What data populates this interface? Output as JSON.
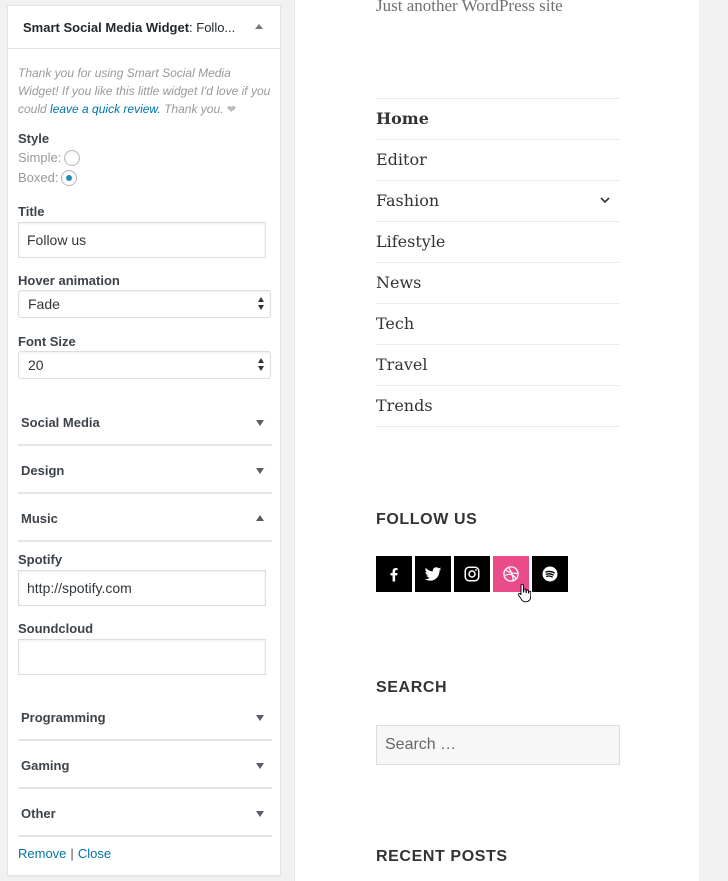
{
  "widget": {
    "title_bold": "Smart Social Media Widget",
    "title_rest": ": Follo...",
    "thanks_pre": "Thank you for using Smart Social Media Widget! If you like this little widget I'd love if you could ",
    "review_link": "leave a quick review.",
    "thanks_post": " Thank you. ",
    "heart": "❤",
    "style_label": "Style",
    "style_simple": "Simple:",
    "style_boxed": "Boxed:",
    "style_selected": "boxed",
    "title_label": "Title",
    "title_value": "Follow us",
    "hover_label": "Hover animation",
    "hover_value": "Fade",
    "font_size_label": "Font Size",
    "font_size_value": "20",
    "sections": [
      {
        "label": "Social Media",
        "state": "collapsed"
      },
      {
        "label": "Design",
        "state": "collapsed"
      },
      {
        "label": "Music",
        "state": "expanded"
      },
      {
        "label": "Programming",
        "state": "collapsed"
      },
      {
        "label": "Gaming",
        "state": "collapsed"
      },
      {
        "label": "Other",
        "state": "collapsed"
      }
    ],
    "spotify_label": "Spotify",
    "spotify_value": "http://spotify.com",
    "soundcloud_label": "Soundcloud",
    "soundcloud_value": "",
    "remove_label": "Remove",
    "separator": "|",
    "close_label": "Close"
  },
  "site": {
    "tagline": "Just another WordPress site",
    "menu": [
      {
        "label": "Home",
        "current": true
      },
      {
        "label": "Editor"
      },
      {
        "label": "Fashion",
        "has_submenu": true
      },
      {
        "label": "Lifestyle"
      },
      {
        "label": "News"
      },
      {
        "label": "Tech"
      },
      {
        "label": "Travel"
      },
      {
        "label": "Trends"
      }
    ],
    "follow_heading": "FOLLOW US",
    "social_icons": [
      {
        "name": "facebook-icon",
        "bg": "#000000"
      },
      {
        "name": "twitter-icon",
        "bg": "#000000"
      },
      {
        "name": "instagram-icon",
        "bg": "#000000"
      },
      {
        "name": "dribbble-icon",
        "bg": "#ea4c89"
      },
      {
        "name": "spotify-icon",
        "bg": "#000000"
      }
    ],
    "search_heading": "SEARCH",
    "search_placeholder": "Search …",
    "recent_heading": "RECENT POSTS"
  },
  "colors": {
    "link": "#0073aa",
    "radio_checked": "#1e8cbe",
    "dribbble_hover": "#ea4c89"
  }
}
